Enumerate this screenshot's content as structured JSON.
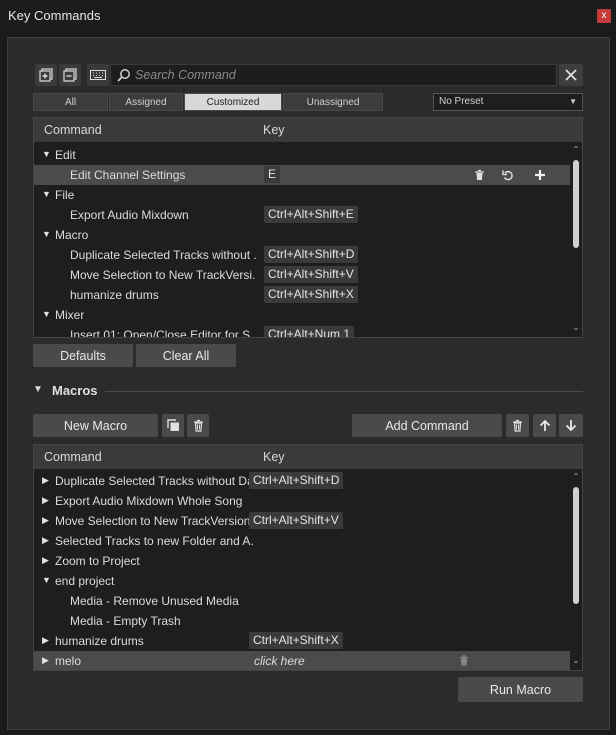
{
  "window": {
    "title": "Key Commands",
    "close_label": "x"
  },
  "toolbar": {
    "search_placeholder": "Search Command",
    "clear_icon": "close-icon"
  },
  "filter_tabs": [
    "All",
    "Assigned",
    "Customized",
    "Unassigned"
  ],
  "active_tab": "Customized",
  "preset": {
    "value": "No Preset"
  },
  "commands_table": {
    "headers": {
      "command": "Command",
      "key": "Key"
    },
    "rows": [
      {
        "type": "group",
        "label": "Edit"
      },
      {
        "type": "item",
        "label": "Edit Channel Settings",
        "key": "E",
        "selected": true
      },
      {
        "type": "group",
        "label": "File"
      },
      {
        "type": "item",
        "label": "Export Audio Mixdown",
        "key": "Ctrl+Alt+Shift+E"
      },
      {
        "type": "group",
        "label": "Macro"
      },
      {
        "type": "item",
        "label": "Duplicate Selected Tracks without .",
        "key": "Ctrl+Alt+Shift+D"
      },
      {
        "type": "item",
        "label": "Move Selection to New TrackVersi.",
        "key": "Ctrl+Alt+Shift+V"
      },
      {
        "type": "item",
        "label": "humanize drums",
        "key": "Ctrl+Alt+Shift+X"
      },
      {
        "type": "group",
        "label": "Mixer"
      },
      {
        "type": "item",
        "label": "Insert 01: Open/Close Editor for S.",
        "key": "Ctrl+Alt+Num 1"
      }
    ]
  },
  "buttons": {
    "defaults": "Defaults",
    "clear_all": "Clear All",
    "new_macro": "New Macro",
    "add_command": "Add Command",
    "run_macro": "Run Macro"
  },
  "macros_section": {
    "title": "Macros"
  },
  "macros_table": {
    "headers": {
      "command": "Command",
      "key": "Key"
    },
    "rows": [
      {
        "type": "macro",
        "expanded": false,
        "label": "Duplicate Selected Tracks without Da",
        "key": "Ctrl+Alt+Shift+D"
      },
      {
        "type": "macro",
        "expanded": false,
        "label": "Export Audio Mixdown Whole Song",
        "key": ""
      },
      {
        "type": "macro",
        "expanded": false,
        "label": "Move Selection to New TrackVersion",
        "key": "Ctrl+Alt+Shift+V"
      },
      {
        "type": "macro",
        "expanded": false,
        "label": "Selected Tracks to new Folder and A.",
        "key": ""
      },
      {
        "type": "macro",
        "expanded": false,
        "label": "Zoom to Project",
        "key": ""
      },
      {
        "type": "macro",
        "expanded": true,
        "label": "end project",
        "key": ""
      },
      {
        "type": "child",
        "label": "Media - Remove Unused Media",
        "key": ""
      },
      {
        "type": "child",
        "label": "Media - Empty Trash",
        "key": ""
      },
      {
        "type": "macro",
        "expanded": false,
        "label": "humanize drums",
        "key": "Ctrl+Alt+Shift+X"
      },
      {
        "type": "macro",
        "expanded": false,
        "label": "melo",
        "key": "click here",
        "selected": true
      }
    ]
  },
  "colors": {
    "background": "#2b2b2b",
    "table_bg": "#1e1e1e",
    "selected_row": "#4b4b4b",
    "active_tab": "#d8d8d8",
    "close_button": "#c43b3b"
  }
}
